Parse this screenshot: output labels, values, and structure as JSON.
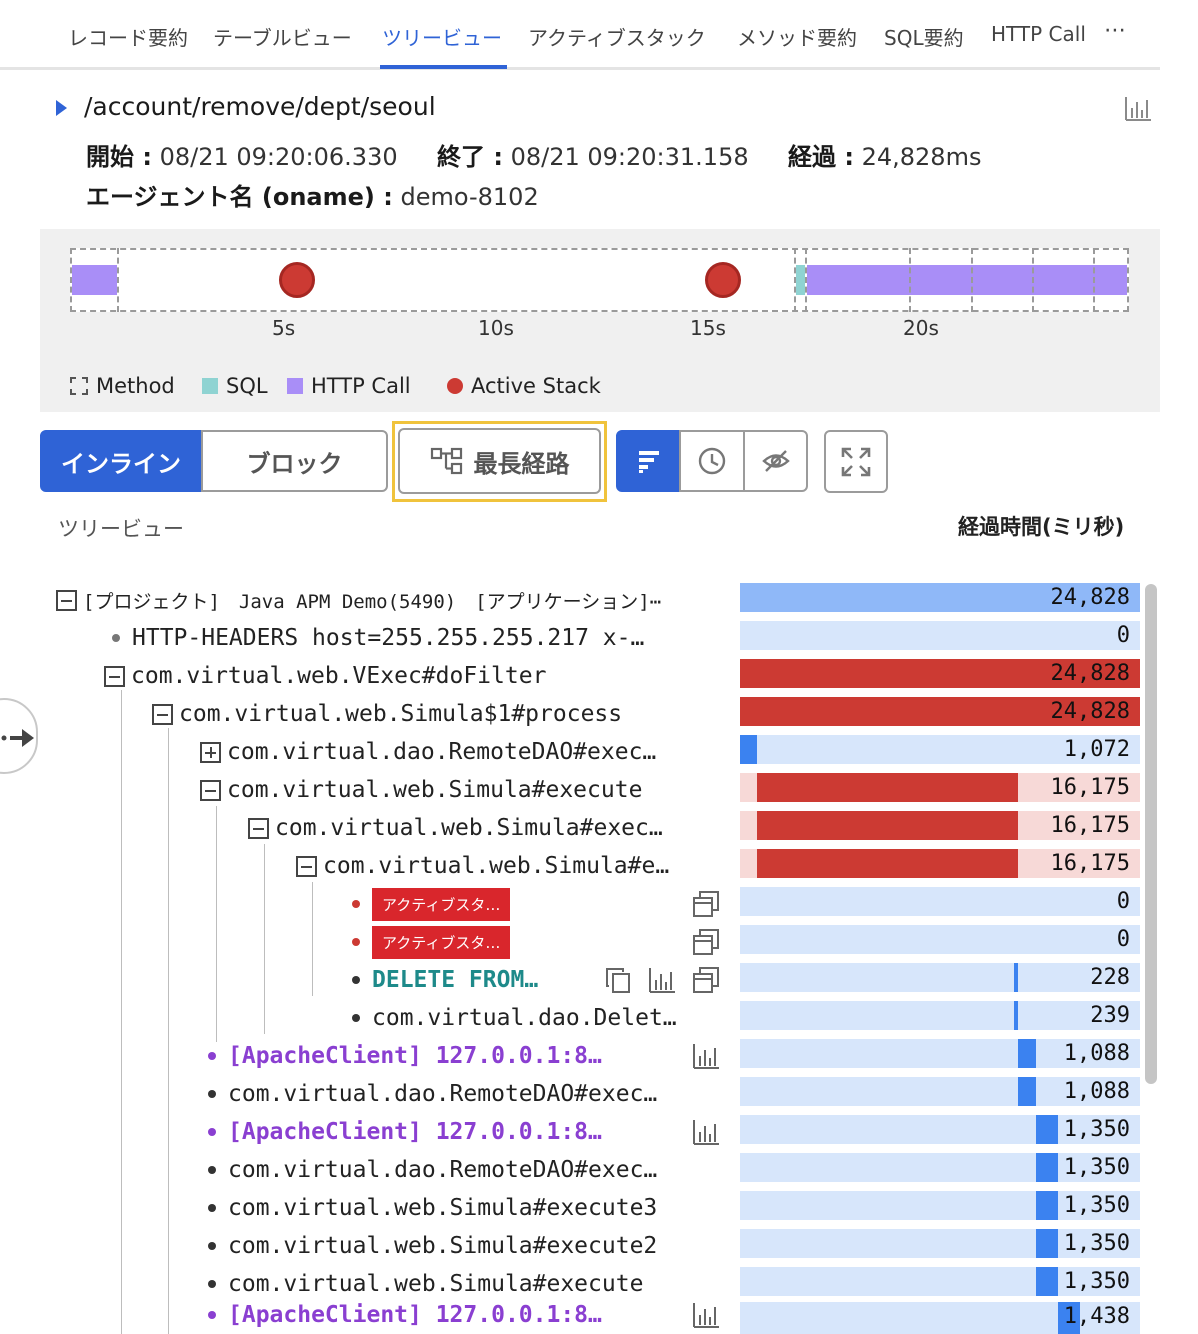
{
  "tabs": [
    {
      "label": "レコード要約",
      "active": false
    },
    {
      "label": "テーブルビュー",
      "active": false
    },
    {
      "label": "ツリービュー",
      "active": true
    },
    {
      "label": "アクティブスタック",
      "active": false
    },
    {
      "label": "メソッド要約",
      "active": false
    },
    {
      "label": "SQL要約",
      "active": false
    },
    {
      "label": "HTTP Call",
      "active": false
    }
  ],
  "tabs_more": "⋯",
  "header": {
    "path": "/account/remove/dept/seoul",
    "start_label": "開始 :",
    "start_value": "08/21 09:20:06.330",
    "end_label": "終了 :",
    "end_value": "08/21 09:20:31.158",
    "elapsed_label": "経過 :",
    "elapsed_value": "24,828ms",
    "agent_label": "エージェント名 (oname) :",
    "agent_value": "demo-8102"
  },
  "timeline": {
    "ticks": [
      "5s",
      "10s",
      "15s",
      "20s"
    ],
    "legend": [
      {
        "label": "Method",
        "kind": "method"
      },
      {
        "label": "SQL",
        "kind": "sql",
        "color": "#8fd3d2"
      },
      {
        "label": "HTTP Call",
        "kind": "http",
        "color": "#a98ef7"
      },
      {
        "label": "Active Stack",
        "kind": "active",
        "color": "#cc3a33"
      }
    ]
  },
  "controls": {
    "inline": "インライン",
    "block": "ブロック",
    "longest_path": "最長経路"
  },
  "columns": {
    "tree": "ツリービュー",
    "elapsed": "経過時間(ミリ秒)"
  },
  "colors": {
    "accent": "#2f63d6",
    "active_stack": "#cc3a33",
    "bar_bg": "#d7e6fb",
    "bar_pink": "#f7d9d7",
    "bar_top": "#8fb8f8",
    "bar_blue": "#3b82f0",
    "sql": "#1e8a8a",
    "http": "#8a3fd1"
  },
  "tree": {
    "rows": [
      {
        "text": "[プロジェクト]　Java APM Demo(5490)　[アプリケーション]⋯",
        "value": "24,828"
      },
      {
        "text": "HTTP-HEADERS host=255.255.255.217 x-…",
        "value": "0"
      },
      {
        "text": "com.virtual.web.VExec#doFilter",
        "value": "24,828"
      },
      {
        "text": "com.virtual.web.Simula$1#process",
        "value": "24,828"
      },
      {
        "text": "com.virtual.dao.RemoteDAO#exec…",
        "value": "1,072"
      },
      {
        "text": "com.virtual.web.Simula#execute",
        "value": "16,175"
      },
      {
        "text": "com.virtual.web.Simula#exec…",
        "value": "16,175"
      },
      {
        "text": "com.virtual.web.Simula#e…",
        "value": "16,175"
      },
      {
        "text": "アクティブスタ…",
        "value": "0"
      },
      {
        "text": "アクティブスタ…",
        "value": "0"
      },
      {
        "text": "DELETE FROM…",
        "value": "228"
      },
      {
        "text": "com.virtual.dao.Delet…",
        "value": "239"
      },
      {
        "text": "[ApacheClient] 127.0.0.1:8…",
        "value": "1,088"
      },
      {
        "text": "com.virtual.dao.RemoteDAO#exec…",
        "value": "1,088"
      },
      {
        "text": "[ApacheClient] 127.0.0.1:8…",
        "value": "1,350"
      },
      {
        "text": "com.virtual.dao.RemoteDAO#exec…",
        "value": "1,350"
      },
      {
        "text": "com.virtual.web.Simula#execute3",
        "value": "1,350"
      },
      {
        "text": "com.virtual.web.Simula#execute2",
        "value": "1,350"
      },
      {
        "text": "com.virtual.web.Simula#execute",
        "value": "1,350"
      },
      {
        "text": "[ApacheClient] 127.0.0.1:8…",
        "value": "1,438"
      }
    ]
  }
}
